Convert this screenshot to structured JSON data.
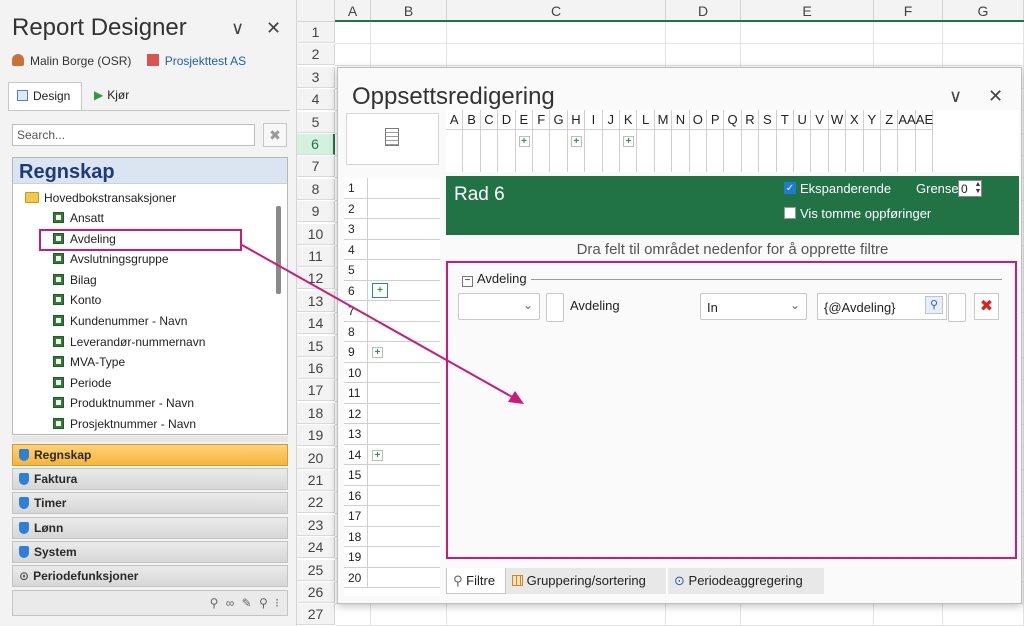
{
  "left_pane": {
    "title": "Report Designer",
    "user": "Malin Borge (OSR)",
    "project": "Prosjekttest AS",
    "tabs": [
      "Design",
      "Kjør"
    ],
    "search_placeholder": "Search...",
    "tree_header": "Regnskap",
    "tree_folder": "Hovedbokstransaksjoner",
    "tree_items": [
      "Ansatt",
      "Avdeling",
      "Avslutningsgruppe",
      "Bilag",
      "Konto",
      "Kundenummer - Navn",
      "Leverandør-nummernavn",
      "MVA-Type",
      "Periode",
      "Produktnummer - Navn",
      "Prosjektnummer - Navn"
    ],
    "highlighted_item": "Avdeling",
    "categories": [
      "Regnskap",
      "Faktura",
      "Timer",
      "Lønn",
      "System",
      "Periodefunksjoner"
    ],
    "active_category": "Regnskap",
    "colors": {
      "highlight": "#cc1a7a",
      "active_category": "#f6b53a"
    }
  },
  "sheet": {
    "columns": [
      "A",
      "B",
      "C",
      "D",
      "E",
      "F",
      "G"
    ],
    "rows": [
      "1",
      "2",
      "3",
      "4",
      "5",
      "6",
      "7",
      "8",
      "9",
      "10",
      "11",
      "12",
      "13",
      "14",
      "15",
      "16",
      "17",
      "18",
      "19",
      "20",
      "21",
      "22",
      "23",
      "24",
      "25",
      "26",
      "27"
    ],
    "selected_row": "6",
    "accent": "#217346"
  },
  "dialog": {
    "title": "Oppsettsredigering",
    "minimize_icon": "∨",
    "close_icon": "✕",
    "strip_columns": [
      "A",
      "B",
      "C",
      "D",
      "E",
      "F",
      "G",
      "H",
      "I",
      "J",
      "K",
      "L",
      "M",
      "N",
      "O",
      "P",
      "Q",
      "R",
      "S",
      "T",
      "U",
      "V",
      "W",
      "X",
      "Y",
      "Z",
      "AA",
      "AE"
    ],
    "strip_rows": [
      "1",
      "2",
      "3",
      "4",
      "5",
      "6",
      "7",
      "8",
      "9",
      "10",
      "11",
      "12",
      "13",
      "14",
      "15",
      "16",
      "17",
      "18",
      "19",
      "20"
    ],
    "row_title": "Rad 6",
    "expanding_label": "Ekspanderende",
    "expanding_checked": true,
    "limit_label": "Grense:",
    "limit_value": "0",
    "show_empty_label": "Vis tomme oppføringer",
    "show_empty_checked": false,
    "hint": "Dra felt til området nedenfor for å opprette filtre",
    "filter_group": "Avdeling",
    "filter": {
      "field": "Avdeling",
      "operator": "In",
      "value": "{@Avdeling}"
    },
    "bottom_tabs": [
      "Filtre",
      "Gruppering/sortering",
      "Periodeaggregering"
    ],
    "active_bottom_tab": "Filtre",
    "header_color": "#217346"
  }
}
